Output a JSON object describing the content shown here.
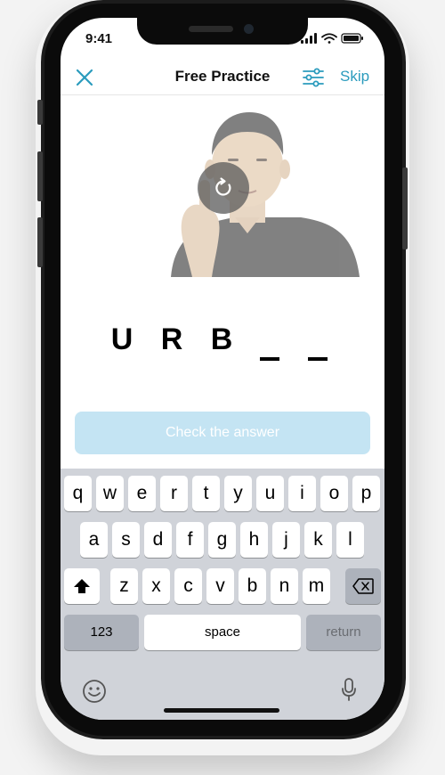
{
  "status_bar": {
    "time": "9:41"
  },
  "header": {
    "title": "Free Practice",
    "skip_label": "Skip"
  },
  "answer": {
    "letters": [
      "U",
      "R",
      "B"
    ],
    "blank_count": 2
  },
  "check_button": {
    "label": "Check the answer"
  },
  "keyboard": {
    "row1": [
      "q",
      "w",
      "e",
      "r",
      "t",
      "y",
      "u",
      "i",
      "o",
      "p"
    ],
    "row2": [
      "a",
      "s",
      "d",
      "f",
      "g",
      "h",
      "j",
      "k",
      "l"
    ],
    "row3": [
      "z",
      "x",
      "c",
      "v",
      "b",
      "n",
      "m"
    ],
    "numbers_label": "123",
    "space_label": "space",
    "return_label": "return"
  },
  "colors": {
    "accent": "#2a9bbd",
    "check_button_bg": "#c4e4f3",
    "keyboard_bg": "#d0d3d9"
  },
  "icons": [
    "close-icon",
    "sliders-icon",
    "replay-icon",
    "shift-icon",
    "backspace-icon",
    "emoji-icon",
    "microphone-icon"
  ]
}
